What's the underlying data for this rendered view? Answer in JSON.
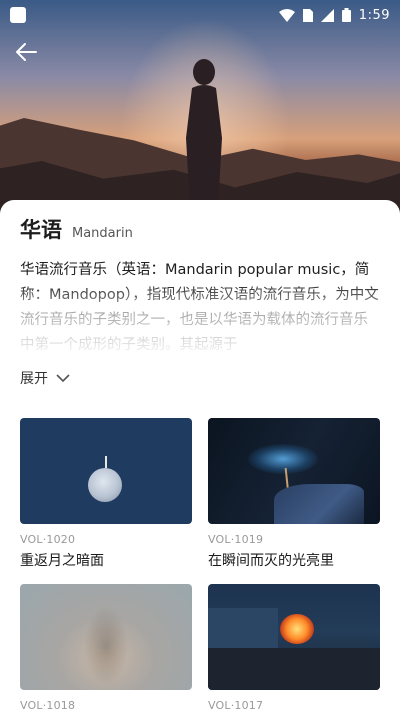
{
  "status_bar": {
    "time": "1:59",
    "icons": [
      "app-notification-icon",
      "wifi-icon",
      "sim-icon",
      "signal-icon",
      "battery-icon"
    ]
  },
  "header": {
    "back_icon": "arrow-left-icon"
  },
  "category": {
    "title": "华语",
    "subtitle": "Mandarin",
    "description": "华语流行音乐（英语：Mandarin popular music，简称：Mandopop），指现代标准汉语的流行音乐，为中文流行音乐的子类别之一，也是以华语为载体的流行音乐中第一个成形的子类别。其起源于",
    "expand_label": "展开",
    "expand_icon": "chevron-down-icon"
  },
  "albums": [
    {
      "vol": "VOL·1020",
      "title": "重返月之暗面"
    },
    {
      "vol": "VOL·1019",
      "title": "在瞬间而灭的光亮里"
    },
    {
      "vol": "VOL·1018",
      "title": ""
    },
    {
      "vol": "VOL·1017",
      "title": ""
    }
  ],
  "colors": {
    "sheet_background": "#ffffff",
    "title_text": "#1c1c1c",
    "vol_text": "#999999"
  }
}
